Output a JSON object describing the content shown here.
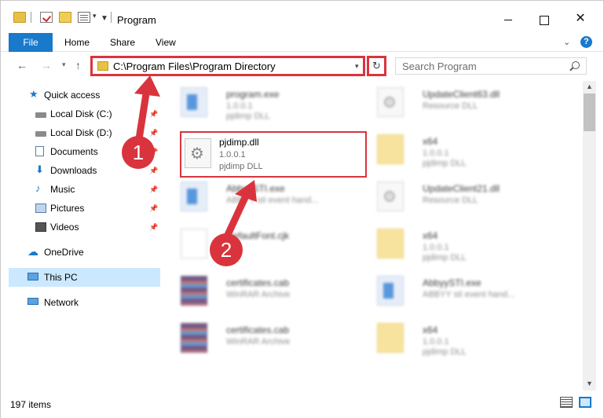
{
  "window": {
    "title": "Program",
    "controls": {
      "minimize": "",
      "maximize": "",
      "close": "✕"
    }
  },
  "ribbon": {
    "tabs": [
      "File",
      "Home",
      "Share",
      "View"
    ],
    "help": "?"
  },
  "nav": {
    "address": "C:\\Program Files\\Program Directory",
    "search_placeholder": "Search Program",
    "refresh": "↻"
  },
  "sidebar": {
    "items": [
      {
        "label": "Quick access",
        "icon": "star-icon",
        "pinned": false
      },
      {
        "label": "Local Disk (C:)",
        "icon": "disk-icon",
        "pinned": true
      },
      {
        "label": "Local Disk (D:)",
        "icon": "disk-icon",
        "pinned": true
      },
      {
        "label": "Documents",
        "icon": "documents-icon",
        "pinned": true
      },
      {
        "label": "Downloads",
        "icon": "download-icon",
        "pinned": true
      },
      {
        "label": "Music",
        "icon": "music-icon",
        "pinned": true
      },
      {
        "label": "Pictures",
        "icon": "pictures-icon",
        "pinned": true
      },
      {
        "label": "Videos",
        "icon": "videos-icon",
        "pinned": true
      },
      {
        "label": "OneDrive",
        "icon": "cloud-icon",
        "pinned": false
      },
      {
        "label": "This PC",
        "icon": "pc-icon",
        "pinned": false,
        "selected": true
      },
      {
        "label": "Network",
        "icon": "network-icon",
        "pinned": false
      }
    ]
  },
  "files": [
    {
      "name": "program.exe",
      "meta1": "1.0.0.1",
      "meta2": "pjdimp DLL",
      "icon": "exe-file-icon"
    },
    {
      "name": "UpdateClient63.dll",
      "meta1": "Resource DLL",
      "meta2": "",
      "icon": "gear-file-icon"
    },
    {
      "name": "pjdimp.dll",
      "meta1": "1.0.0.1",
      "meta2": "pjdimp DLL",
      "icon": "gear-file-icon",
      "highlighted": true
    },
    {
      "name": "x64",
      "meta1": "1.0.0.1",
      "meta2": "pjdimp DLL",
      "icon": "folder-file-icon"
    },
    {
      "name": "AbbyySTI.exe",
      "meta1": "ABBYY sti event hand...",
      "meta2": "",
      "icon": "exe-file-icon"
    },
    {
      "name": "UpdateClient21.dll",
      "meta1": "Resource DLL",
      "meta2": "",
      "icon": "gear-file-icon"
    },
    {
      "name": "DefaultFont.cjk",
      "meta1": "",
      "meta2": "",
      "icon": "font-file-icon"
    },
    {
      "name": "x64",
      "meta1": "1.0.0.1",
      "meta2": "pjdimp DLL",
      "icon": "folder-file-icon"
    },
    {
      "name": "certificates.cab",
      "meta1": "WinRAR Archive",
      "meta2": "",
      "icon": "cab-file-icon"
    },
    {
      "name": "AbbyySTI.exe",
      "meta1": "ABBYY sti event hand...",
      "meta2": "",
      "icon": "exe-file-icon"
    },
    {
      "name": "certificates.cab",
      "meta1": "WinRAR Archive",
      "meta2": "",
      "icon": "cab-file-icon"
    },
    {
      "name": "x64",
      "meta1": "1.0.0.1",
      "meta2": "pjdimp DLL",
      "icon": "folder-file-icon"
    }
  ],
  "status": {
    "item_count": "197 items"
  },
  "annotations": {
    "marker1": "1",
    "marker2": "2"
  },
  "colors": {
    "accent": "#1979ca",
    "highlight": "#d9343d",
    "selection": "#cce8ff"
  }
}
